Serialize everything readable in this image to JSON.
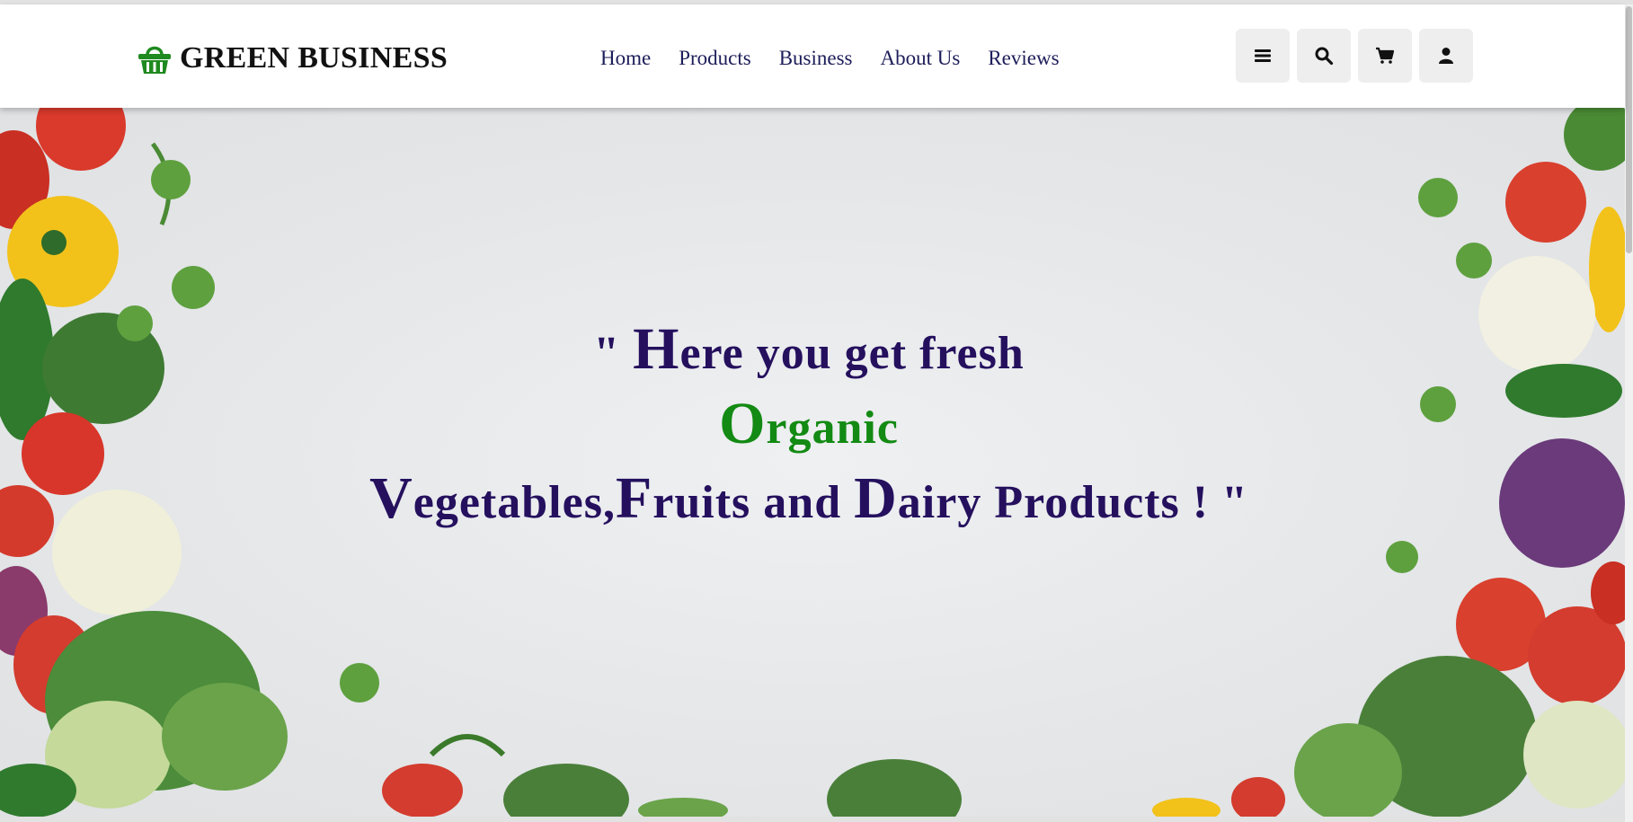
{
  "brand": {
    "name": "GREEN BUSINESS",
    "icon": "basket-icon",
    "icon_color": "#1f8a1f"
  },
  "nav": {
    "items": [
      {
        "label": "Home"
      },
      {
        "label": "Products"
      },
      {
        "label": "Business"
      },
      {
        "label": "About Us"
      },
      {
        "label": "Reviews"
      }
    ]
  },
  "actions": [
    {
      "icon": "menu-icon"
    },
    {
      "icon": "search-icon"
    },
    {
      "icon": "cart-icon"
    },
    {
      "icon": "user-icon"
    }
  ],
  "hero": {
    "line1": {
      "p1": "\" ",
      "c1": "H",
      "r1": "ere you get fresh"
    },
    "line2": {
      "c1": "O",
      "r1": "rganic"
    },
    "line3": {
      "c1": "V",
      "r1": "egetables,",
      "c2": "F",
      "r2": "ruits and ",
      "c3": "D",
      "r3": "airy Products ! \""
    },
    "text_color": "#25105e",
    "accent_color": "#138a13"
  }
}
